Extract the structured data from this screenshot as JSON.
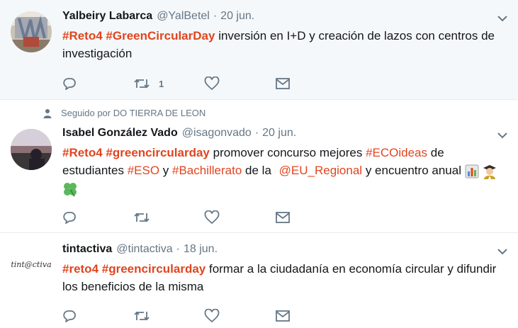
{
  "tweets": [
    {
      "context": "",
      "fullname": "Yalbeiry Labarca",
      "username": "@YalBetel",
      "separator": "·",
      "time": "20 jun.",
      "tags": [
        "#Reto4",
        "#GreenCircularDay"
      ],
      "text_parts": [
        "inversión en I+D y creación de lazos con centros de investigación"
      ],
      "retweet_count": "1",
      "avatar": "photo"
    },
    {
      "context": "Seguido por DO TIERRA DE LEON",
      "fullname": "Isabel González Vado",
      "username": "@isagonvado",
      "separator": "·",
      "time": "20 jun.",
      "tags": [
        "#Reto4",
        "#greencircularday",
        "#ECOideas",
        "#ESO",
        "#Bachillerato",
        "@EU_Regional"
      ],
      "text_parts": [
        "promover concurso mejores",
        "de estudiantes",
        "y",
        "de la",
        "y encuentro anual"
      ],
      "retweet_count": "",
      "avatar": "photo"
    },
    {
      "context": "",
      "fullname": "tintactiva",
      "username": "@tintactiva",
      "separator": "·",
      "time": "18 jun.",
      "tags": [
        "#reto4",
        "#greencircularday"
      ],
      "text_parts": [
        "formar a la ciudadanía en economía circular y difundir los beneficios de la misma"
      ],
      "retweet_count": "",
      "avatar": "logo",
      "logo_text": "tint@ctiva"
    }
  ],
  "icons": {
    "reply": "reply-icon",
    "retweet": "retweet-icon",
    "like": "heart-icon",
    "message": "envelope-icon",
    "caret": "chevron-down-icon",
    "context": "person-icon"
  },
  "colors": {
    "hashtag": "#e0451f",
    "secondary_text": "#657786",
    "highlight_bg": "#f5f8fa",
    "icon": "#657786"
  }
}
